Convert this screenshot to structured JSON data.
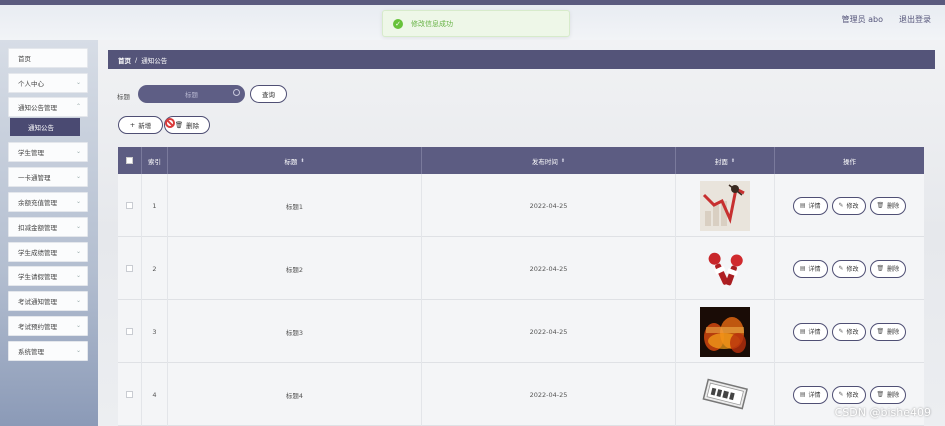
{
  "header": {
    "user_label": "管理员 abo",
    "logout_label": "退出登录"
  },
  "toast": {
    "message": "修改信息成功",
    "icon": "check-circle-icon",
    "color": "#67c23a"
  },
  "sidebar": {
    "items": [
      {
        "label": "首页"
      },
      {
        "label": "个人中心"
      },
      {
        "label": "通知公告管理"
      },
      {
        "label": "学生管理"
      },
      {
        "label": "一卡通管理"
      },
      {
        "label": "余额充值管理"
      },
      {
        "label": "扣减金额管理"
      },
      {
        "label": "学生成绩管理"
      },
      {
        "label": "学生请假管理"
      },
      {
        "label": "考试通知管理"
      },
      {
        "label": "考试预约管理"
      },
      {
        "label": "系统管理"
      }
    ],
    "sub_item": "通知公告"
  },
  "breadcrumb": {
    "home": "首页",
    "separator": "/",
    "current": "通知公告"
  },
  "search": {
    "label": "标题",
    "placeholder": "标题",
    "button": "查询"
  },
  "toolbar": {
    "add_label": "新增",
    "delete_label": "删除"
  },
  "table": {
    "columns": {
      "index": "索引",
      "title": "标题",
      "publish_time": "发布时间",
      "cover": "封面",
      "actions": "操作"
    },
    "sort_glyph": "⬍",
    "rows": [
      {
        "index": "1",
        "title": "标题1",
        "date": "2022-04-25",
        "cover": "chart-crash-image"
      },
      {
        "index": "2",
        "title": "标题2",
        "date": "2022-04-25",
        "cover": "microphones-image"
      },
      {
        "index": "3",
        "title": "标题3",
        "date": "2022-04-25",
        "cover": "fire-text-image"
      },
      {
        "index": "4",
        "title": "标题4",
        "date": "2022-04-25",
        "cover": "news-badge-image"
      }
    ],
    "row_actions": {
      "detail": "详情",
      "edit": "修改",
      "delete": "删除"
    }
  },
  "watermark": "CSDN @bishe409",
  "colors": {
    "primary": "#545479",
    "success": "#67c23a",
    "danger": "#d93a3a"
  }
}
